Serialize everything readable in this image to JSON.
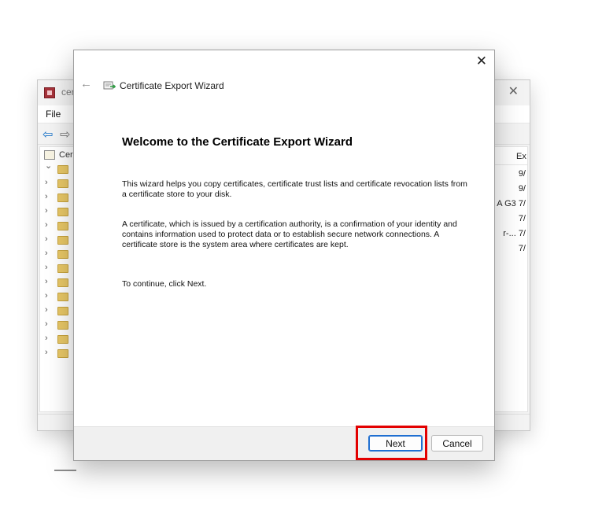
{
  "background_window": {
    "title": "cer",
    "menu": [
      "File"
    ],
    "tree_root_label": "Cer",
    "tree_rows": 14,
    "list_column_header": "Ex",
    "list_cells": [
      {
        "row": 0,
        "text": "9/"
      },
      {
        "row": 1,
        "text": "9/"
      },
      {
        "row": 2,
        "text": "A G3  7/"
      },
      {
        "row": 3,
        "text": "7/"
      },
      {
        "row": 4,
        "text": "r-...  7/"
      },
      {
        "row": 5,
        "text": "7/"
      }
    ]
  },
  "wizard": {
    "title": "Certificate Export Wizard",
    "close_glyph": "✕",
    "back_glyph": "←",
    "heading": "Welcome to the Certificate Export Wizard",
    "paragraphs": [
      "This wizard helps you copy certificates, certificate trust lists and certificate revocation lists from a certificate store to your disk.",
      "A certificate, which is issued by a certification authority, is a confirmation of your identity and contains information used to protect data or to establish secure network connections. A certificate store is the system area where certificates are kept.",
      "To continue, click Next."
    ],
    "buttons": {
      "next": "Next",
      "cancel": "Cancel"
    }
  },
  "icons": {
    "wizard_icon": "certificate-icon",
    "back": "arrow-left-icon",
    "close": "close-icon",
    "folder": "folder-icon",
    "chevron": "chevron-right-icon"
  },
  "colors": {
    "highlight": "#e30000",
    "accent": "#1f6fd1"
  }
}
